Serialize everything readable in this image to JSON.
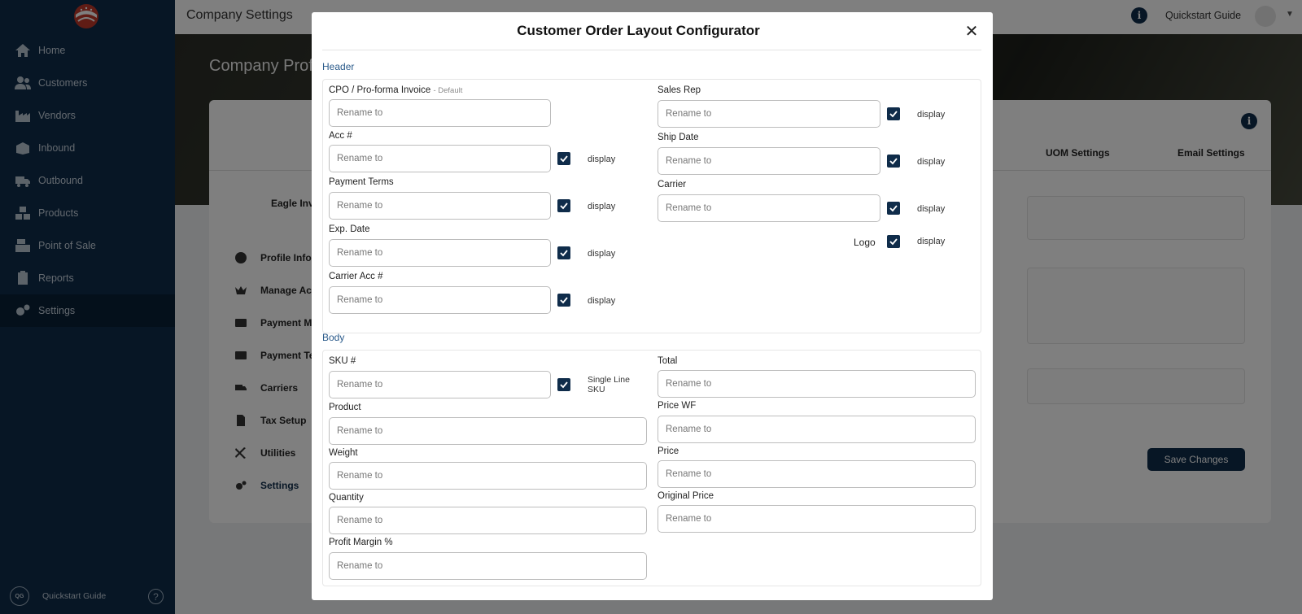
{
  "colors": {
    "sidebar_bg": "#0f2c4a",
    "accent": "#0f2c4a",
    "section_label": "#2a5a8a"
  },
  "sidebar": {
    "items": [
      {
        "label": "Home",
        "icon": "home-icon"
      },
      {
        "label": "Customers",
        "icon": "customers-icon"
      },
      {
        "label": "Vendors",
        "icon": "vendors-icon"
      },
      {
        "label": "Inbound",
        "icon": "inbound-icon"
      },
      {
        "label": "Outbound",
        "icon": "outbound-icon"
      },
      {
        "label": "Products",
        "icon": "products-icon"
      },
      {
        "label": "Point of Sale",
        "icon": "point-of-sale-icon"
      },
      {
        "label": "Reports",
        "icon": "reports-icon"
      },
      {
        "label": "Settings",
        "icon": "settings-icon"
      }
    ],
    "active": "Settings",
    "bottom": {
      "badge": "QG",
      "label": "Quickstart Guide",
      "help_icon": "help-icon"
    }
  },
  "topbar": {
    "title": "Company Settings",
    "quickstart": "Quickstart Guide",
    "info_icon": "i"
  },
  "page": {
    "hero_title": "Company Prof",
    "tabs": [
      "UOM Settings",
      "Email Settings"
    ],
    "company_name": "Eagle Inv",
    "menu": [
      "Profile Info",
      "Manage Ac",
      "Payment M",
      "Payment Te",
      "Carriers",
      "Tax Setup",
      "Utilities",
      "Settings"
    ],
    "save_label": "Save Changes"
  },
  "modal": {
    "title": "Customer Order Layout Configurator",
    "close_symbol": "✕",
    "header_section": "Header",
    "body_section": "Body",
    "placeholder": "Rename to",
    "display_label": "display",
    "header": {
      "cpo": {
        "label": "CPO / Pro-forma Invoice",
        "suffix": "- Default"
      },
      "acc": {
        "label": "Acc #"
      },
      "payment_terms": {
        "label": "Payment Terms"
      },
      "exp_date": {
        "label": "Exp. Date"
      },
      "carrier_acc": {
        "label": "Carrier Acc #"
      },
      "sales_rep": {
        "label": "Sales Rep"
      },
      "ship_date": {
        "label": "Ship Date"
      },
      "carrier": {
        "label": "Carrier"
      },
      "logo": {
        "label": "Logo"
      }
    },
    "body": {
      "sku": {
        "label": "SKU #",
        "option": "Single Line SKU"
      },
      "product": {
        "label": "Product"
      },
      "weight": {
        "label": "Weight"
      },
      "quantity": {
        "label": "Quantity"
      },
      "profit_margin": {
        "label": "Profit Margin %"
      },
      "total": {
        "label": "Total"
      },
      "price_wf": {
        "label": "Price WF"
      },
      "price": {
        "label": "Price"
      },
      "original_price": {
        "label": "Original Price"
      }
    }
  }
}
